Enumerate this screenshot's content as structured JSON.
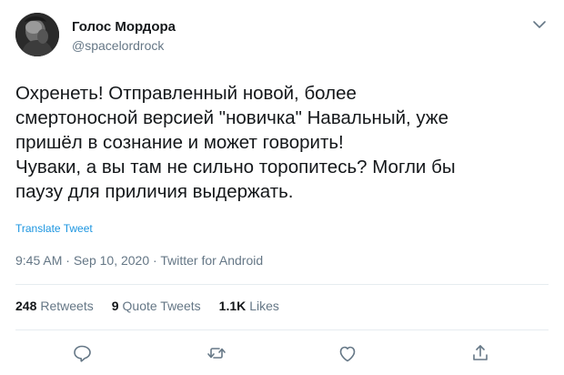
{
  "author": {
    "display_name": "Голос Мордора",
    "handle": "@spacelordrock",
    "avatar_icon": "avatar-photo"
  },
  "tweet": {
    "text": "Охренеть! Отправленный новой, более\nсмертоносной версией \"новичка\" Навальный, уже\nпришёл в сознание и может говорить!\nЧуваки, а вы там не сильно торопитесь? Могли бы\nпаузу для приличия выдержать.",
    "translate_label": "Translate Tweet"
  },
  "meta": {
    "time": "9:45 AM",
    "separator1": " · ",
    "date": "Sep 10, 2020",
    "separator2": " · ",
    "source": "Twitter for Android"
  },
  "stats": {
    "retweets_count": "248",
    "retweets_label": "Retweets",
    "quote_count": "9",
    "quote_label": "Quote Tweets",
    "likes_count": "1.1K",
    "likes_label": "Likes"
  },
  "actions": [
    "reply-icon",
    "retweet-icon",
    "like-icon",
    "share-icon"
  ],
  "colors": {
    "text": "#14171a",
    "secondary": "#657786",
    "link": "#1b95e0",
    "divider": "#e6ecf0",
    "icon": "#657786"
  }
}
